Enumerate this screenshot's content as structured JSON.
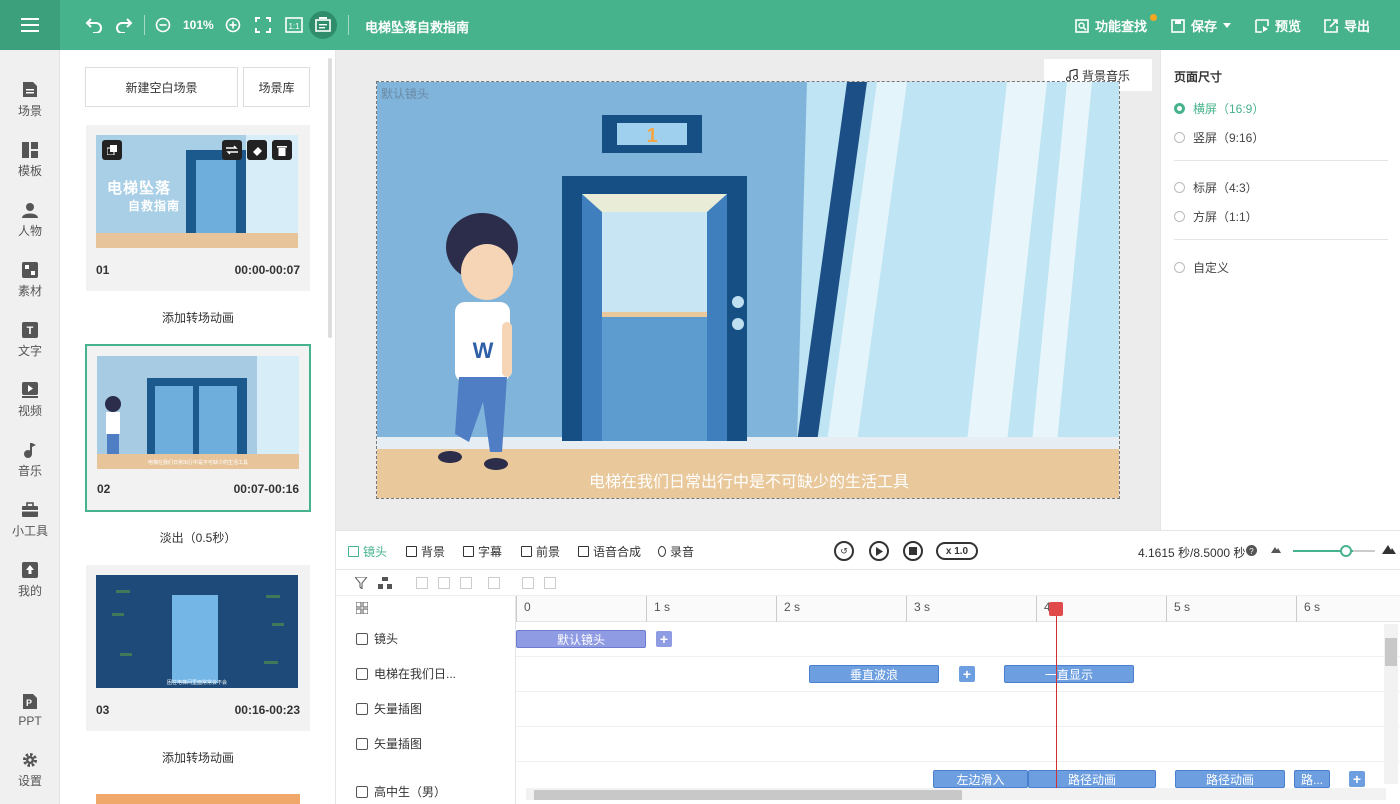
{
  "app": {
    "doc_title": "电梯坠落自救指南",
    "zoom": "101%",
    "colors": {
      "accent": "#47b38c",
      "clip_blue": "#6d9fe0",
      "clip_purple": "#8f9be2",
      "playhead": "#d03030"
    }
  },
  "toolbar_right": {
    "find": "功能查找",
    "save": "保存",
    "preview": "预览",
    "export": "导出"
  },
  "nav": [
    {
      "label": "场景",
      "icon": "scene-icon"
    },
    {
      "label": "模板",
      "icon": "template-icon"
    },
    {
      "label": "人物",
      "icon": "person-icon"
    },
    {
      "label": "素材",
      "icon": "material-icon"
    },
    {
      "label": "文字",
      "icon": "text-icon"
    },
    {
      "label": "视频",
      "icon": "video-icon"
    },
    {
      "label": "音乐",
      "icon": "music-icon"
    },
    {
      "label": "小工具",
      "icon": "toolbox-icon"
    },
    {
      "label": "我的",
      "icon": "upload-icon"
    },
    {
      "label": "PPT",
      "icon": "ppt-icon"
    },
    {
      "label": "设置",
      "icon": "gear-icon"
    }
  ],
  "scene_panel": {
    "new_blank": "新建空白场景",
    "library": "场景库",
    "scenes": [
      {
        "num": "01",
        "time": "00:00-00:07",
        "thumb_title_1": "电梯坠落",
        "thumb_title_2": "自救指南",
        "after": "添加转场动画"
      },
      {
        "num": "02",
        "time": "00:07-00:16",
        "thumb_caption": "电梯在我们日常出行中是不可缺少的生活工具",
        "after": "淡出（0.5秒）"
      },
      {
        "num": "03",
        "time": "00:16-00:23",
        "thumb_caption": "困在电梯间里面常常会不会",
        "after": "添加转场动画"
      }
    ]
  },
  "canvas": {
    "bgm": "背景音乐",
    "camera_label": "默认镜头",
    "elevator_floor": "1",
    "shirt_letter": "W",
    "subtitle": "电梯在我们日常出行中是不可缺少的生活工具"
  },
  "page_size": {
    "title": "页面尺寸",
    "options": [
      {
        "label": "横屏（16:9）",
        "selected": true
      },
      {
        "label": "竖屏（9:16）",
        "selected": false
      },
      {
        "label": "标屏（4:3）",
        "selected": false
      },
      {
        "label": "方屏（1:1）",
        "selected": false
      },
      {
        "label": "自定义",
        "selected": false
      }
    ]
  },
  "timeline": {
    "tabs": [
      "镜头",
      "背景",
      "字幕",
      "前景",
      "语音合成",
      "录音"
    ],
    "speed": "x 1.0",
    "timecode": "4.1615 秒/8.5000 秒",
    "ruler": [
      "0",
      "1 s",
      "2 s",
      "3 s",
      "4",
      "5 s",
      "6 s"
    ],
    "tracks": [
      {
        "label": "镜头",
        "icon": "camera-icon"
      },
      {
        "label": "电梯在我们日...",
        "icon": "text-icon"
      },
      {
        "label": "矢量插图",
        "icon": "vector-icon"
      },
      {
        "label": "矢量插图",
        "icon": "vector-icon"
      },
      {
        "label": "高中生（男）",
        "icon": "figure-icon"
      }
    ],
    "clips": {
      "camera": "默认镜头",
      "text_1": "垂直波浪",
      "text_2": "一直显示",
      "figure_1": "左边滑入",
      "figure_2": "路径动画",
      "figure_3": "路径动画",
      "figure_4": "路..."
    }
  }
}
